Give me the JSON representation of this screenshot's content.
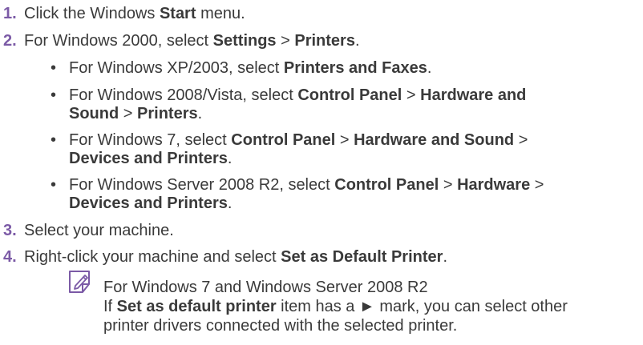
{
  "steps": [
    {
      "number": "1.",
      "parts": [
        "Click the Windows ",
        "Start",
        " menu."
      ]
    },
    {
      "number": "2.",
      "parts": [
        "For Windows 2000, select ",
        "Settings",
        " > ",
        "Printers",
        "."
      ]
    },
    {
      "number": "3.",
      "parts": [
        "Select your machine."
      ]
    },
    {
      "number": "4.",
      "parts": [
        "Right-click your machine and select ",
        "Set as Default Printer",
        "."
      ]
    }
  ],
  "subitems": [
    {
      "bullet": "•",
      "lines": [
        [
          "For Windows XP/2003, select ",
          "Printers and Faxes",
          "."
        ]
      ]
    },
    {
      "bullet": "•",
      "lines": [
        [
          "For Windows 2008/Vista, select ",
          "Control Panel",
          " > ",
          "Hardware and"
        ],
        [
          "",
          "Sound",
          " > ",
          "Printers",
          "."
        ]
      ]
    },
    {
      "bullet": "•",
      "lines": [
        [
          "For Windows 7, select ",
          "Control Panel",
          " > ",
          "Hardware and Sound",
          " >"
        ],
        [
          "",
          "Devices and Printers",
          "."
        ]
      ]
    },
    {
      "bullet": "•",
      "lines": [
        [
          "For Windows Server 2008 R2, select ",
          "Control Panel",
          " > ",
          "Hardware",
          " >"
        ],
        [
          "",
          "Devices and Printers",
          "."
        ]
      ]
    }
  ],
  "note": {
    "icon": "note-pencil-icon",
    "title": "For Windows 7 and Windows Server 2008 R2",
    "line1": [
      "If ",
      "Set as default printer",
      " item has a ► mark, you can select other"
    ],
    "line2": "printer drivers connected with the selected printer."
  },
  "colors": {
    "number": "#7b5aa6",
    "text": "#3a3a3a",
    "icon": "#7b5aa6"
  }
}
